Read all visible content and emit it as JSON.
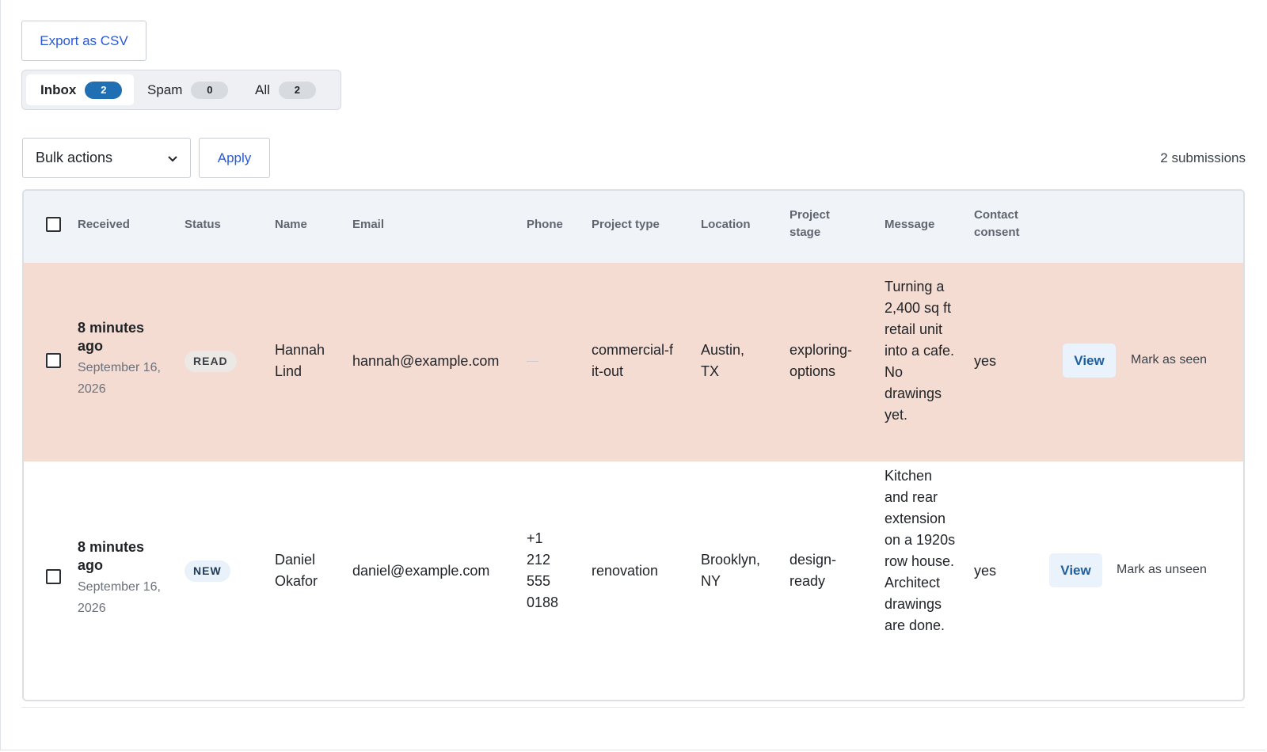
{
  "toolbar": {
    "export_label": "Export as CSV"
  },
  "tabs": [
    {
      "label": "Inbox",
      "count": "2",
      "active": true
    },
    {
      "label": "Spam",
      "count": "0",
      "active": false
    },
    {
      "label": "All",
      "count": "2",
      "active": false
    }
  ],
  "bulk": {
    "selected": "Bulk actions",
    "apply_label": "Apply"
  },
  "submission_count": "2 submissions",
  "table": {
    "headers": {
      "received": "Received",
      "status": "Status",
      "name": "Name",
      "email": "Email",
      "phone": "Phone",
      "project_type": "Project type",
      "location": "Location",
      "project_stage_1": "Project",
      "project_stage_2": "stage",
      "message": "Message",
      "contact_consent_1": "Contact",
      "contact_consent_2": "consent"
    },
    "rows": [
      {
        "received_rel": "8 minutes ago",
        "received_date": "September 16, 2026",
        "status": "READ",
        "name": "Hannah Lind",
        "email": "hannah@example.com",
        "phone": "—",
        "project_type": "commercial-fit-out",
        "location": "Austin, TX",
        "project_stage": "exploring-options",
        "message": "Turning a 2,400 sq ft retail unit into a cafe. No drawings yet.",
        "contact_consent": "yes",
        "view_label": "View",
        "toggle_label": "Mark as seen"
      },
      {
        "received_rel": "8 minutes ago",
        "received_date": "September 16, 2026",
        "status": "NEW",
        "name": "Daniel Okafor",
        "email": "daniel@example.com",
        "phone": "+1 212 555 0188",
        "project_type": "renovation",
        "location": "Brooklyn, NY",
        "project_stage": "design-ready",
        "message": "Kitchen and rear extension on a 1920s row house. Architect drawings are done.",
        "contact_consent": "yes",
        "view_label": "View",
        "toggle_label": "Mark as unseen"
      }
    ]
  },
  "colors": {
    "accent": "#2a5ad6",
    "active_badge": "#1f6fb2",
    "read_row_bg": "#f4dcd2",
    "header_bg": "#f0f3f7"
  }
}
